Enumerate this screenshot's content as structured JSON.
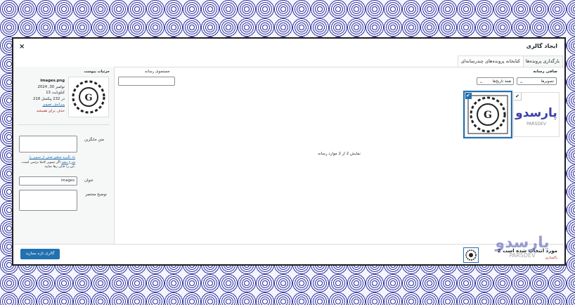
{
  "modal": {
    "title": "ایجاد گالری",
    "close_symbol": "×",
    "tabs": [
      "بارگذاری پرونده‌ها",
      "کتابخانه پرونده‌های چندرسانه‌ای"
    ]
  },
  "library": {
    "filter_title": "صافی رسانه",
    "type_select": "تصویرها",
    "date_select": "همهٔ تاریخ‌ها",
    "search_label": "جستجوی رسانه",
    "count_text": "نمایش 2 از 2 موارد رسانه",
    "thumbs": [
      {
        "icon": "parsdev-logo-icon",
        "brand": "پارسدو",
        "sub": "PARSDEV"
      },
      {
        "icon": "wordpress-pattern-icon",
        "brand": "G"
      }
    ]
  },
  "details": {
    "heading": "جزئیات پیوست",
    "filename": "images.png",
    "date": "نوامبر 30, 2024",
    "size": "13 کیلوبایت",
    "dimensions": "218 در 232 پیکسل",
    "edit_link": "ویرایش تصویر",
    "delete_link": "حذف برای همیشه",
    "alt_label": "متن جایگزین",
    "help_link1": "یاد بگیرید چطور هدف از تصویر را",
    "help_link2": "شرح دهید",
    "help_text": "اگر تصویر کاملا تزئینی است، این را خالی رها نمایید.",
    "title_label": "عنوان",
    "title_value": "images",
    "caption_label": "توضیح مختصر"
  },
  "toolbar": {
    "selected_text": "2 مورد انتخاب شده است",
    "clear_label": "پاکسازی",
    "create_button": "گالری تازه بسازید"
  },
  "watermark": {
    "brand": "پارسدو",
    "sub": "PARSDEV"
  },
  "colors": {
    "accent": "#2271b1",
    "danger": "#b32d2e",
    "pattern": "#3b3fa8"
  }
}
